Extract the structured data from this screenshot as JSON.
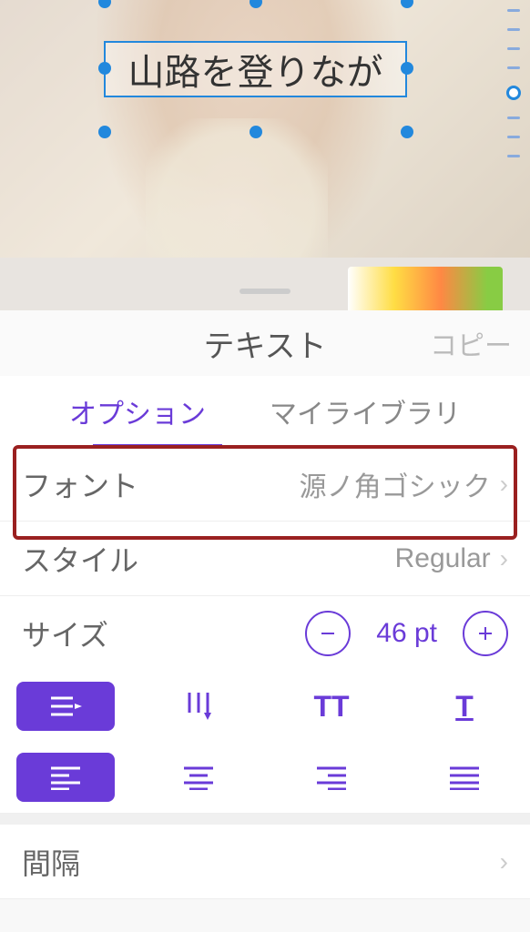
{
  "canvas": {
    "text_content": "山路を登りなが"
  },
  "panel": {
    "title": "テキスト",
    "copy_label": "コピー"
  },
  "tabs": {
    "options": "オプション",
    "library": "マイライブラリ"
  },
  "rows": {
    "font": {
      "label": "フォント",
      "value": "源ノ角ゴシック"
    },
    "style": {
      "label": "スタイル",
      "value": "Regular"
    },
    "size": {
      "label": "サイズ",
      "value": "46 pt"
    },
    "spacing": {
      "label": "間隔"
    }
  },
  "colors": {
    "accent": "#6a3bd8",
    "selection": "#2288dd",
    "highlight": "#9a2020"
  }
}
